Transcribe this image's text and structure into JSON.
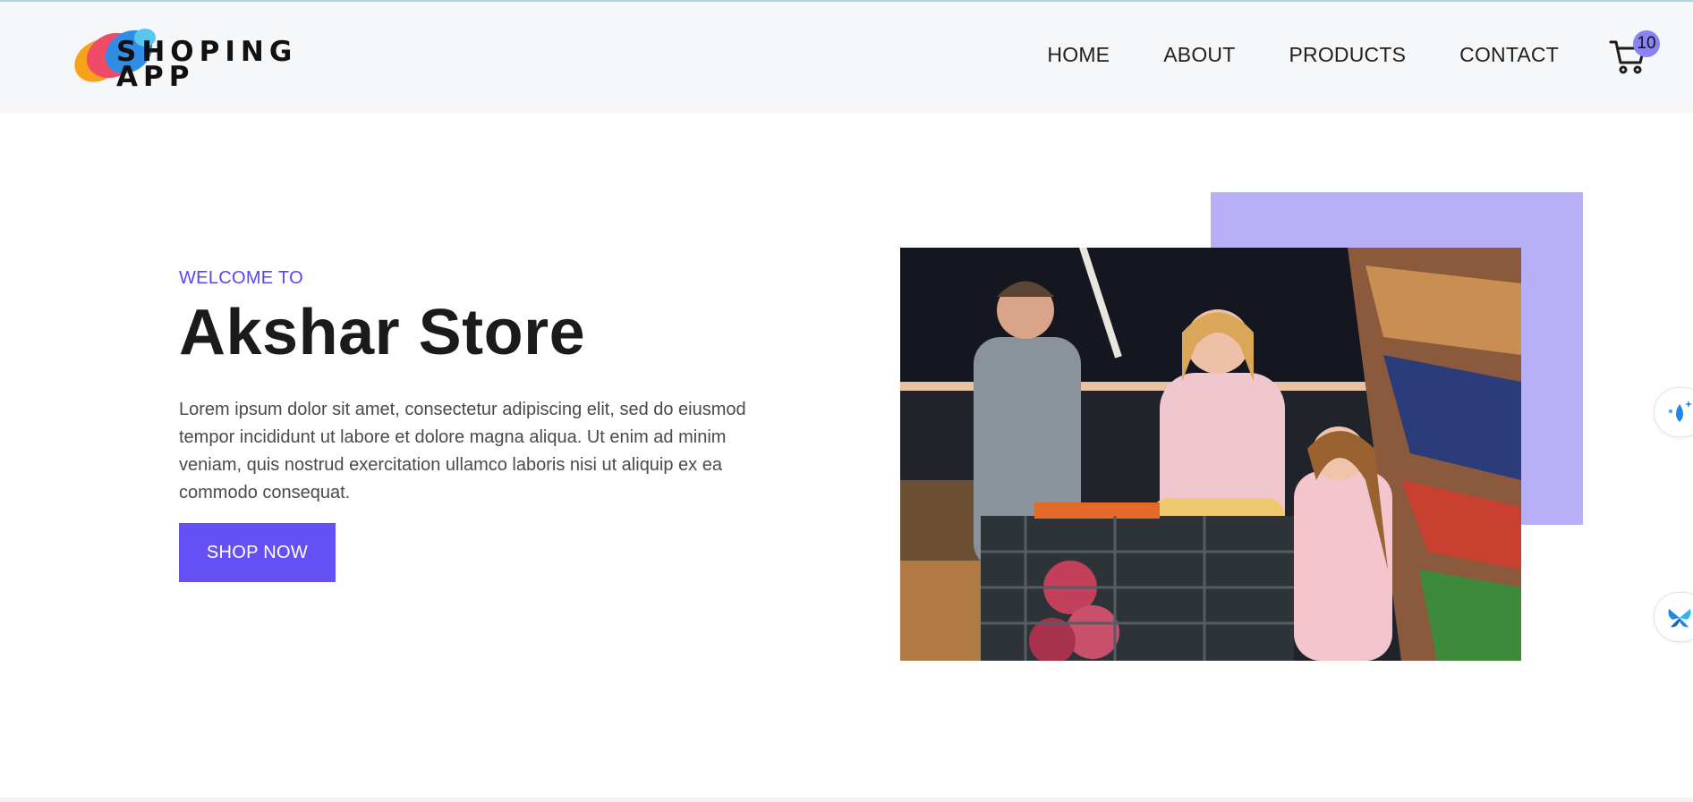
{
  "brand": {
    "logo_line1": "SHOPING",
    "logo_line2": "APP"
  },
  "nav": {
    "items": [
      {
        "label": "HOME"
      },
      {
        "label": "ABOUT"
      },
      {
        "label": "PRODUCTS"
      },
      {
        "label": "CONTACT"
      }
    ]
  },
  "cart": {
    "icon": "cart-icon",
    "count": "10"
  },
  "hero": {
    "eyebrow": "WELCOME TO",
    "title": "Akshar Store",
    "description": "Lorem ipsum dolor sit amet, consectetur adipiscing elit, sed do eiusmod tempor incididunt ut labore et dolore magna aliqua. Ut enim ad minim veniam, quis nostrud exercitation ullamco laboris nisi ut aliquip ex ea commodo consequat.",
    "cta_label": "SHOP NOW"
  },
  "floating": {
    "icon1": "water-drop-sparkle-icon",
    "icon2": "butterfly-icon"
  },
  "colors": {
    "accent": "#6550f4",
    "accent_light": "#b8b0f6",
    "badge": "#8b83f4",
    "nav_bg": "#f6f7f9"
  }
}
